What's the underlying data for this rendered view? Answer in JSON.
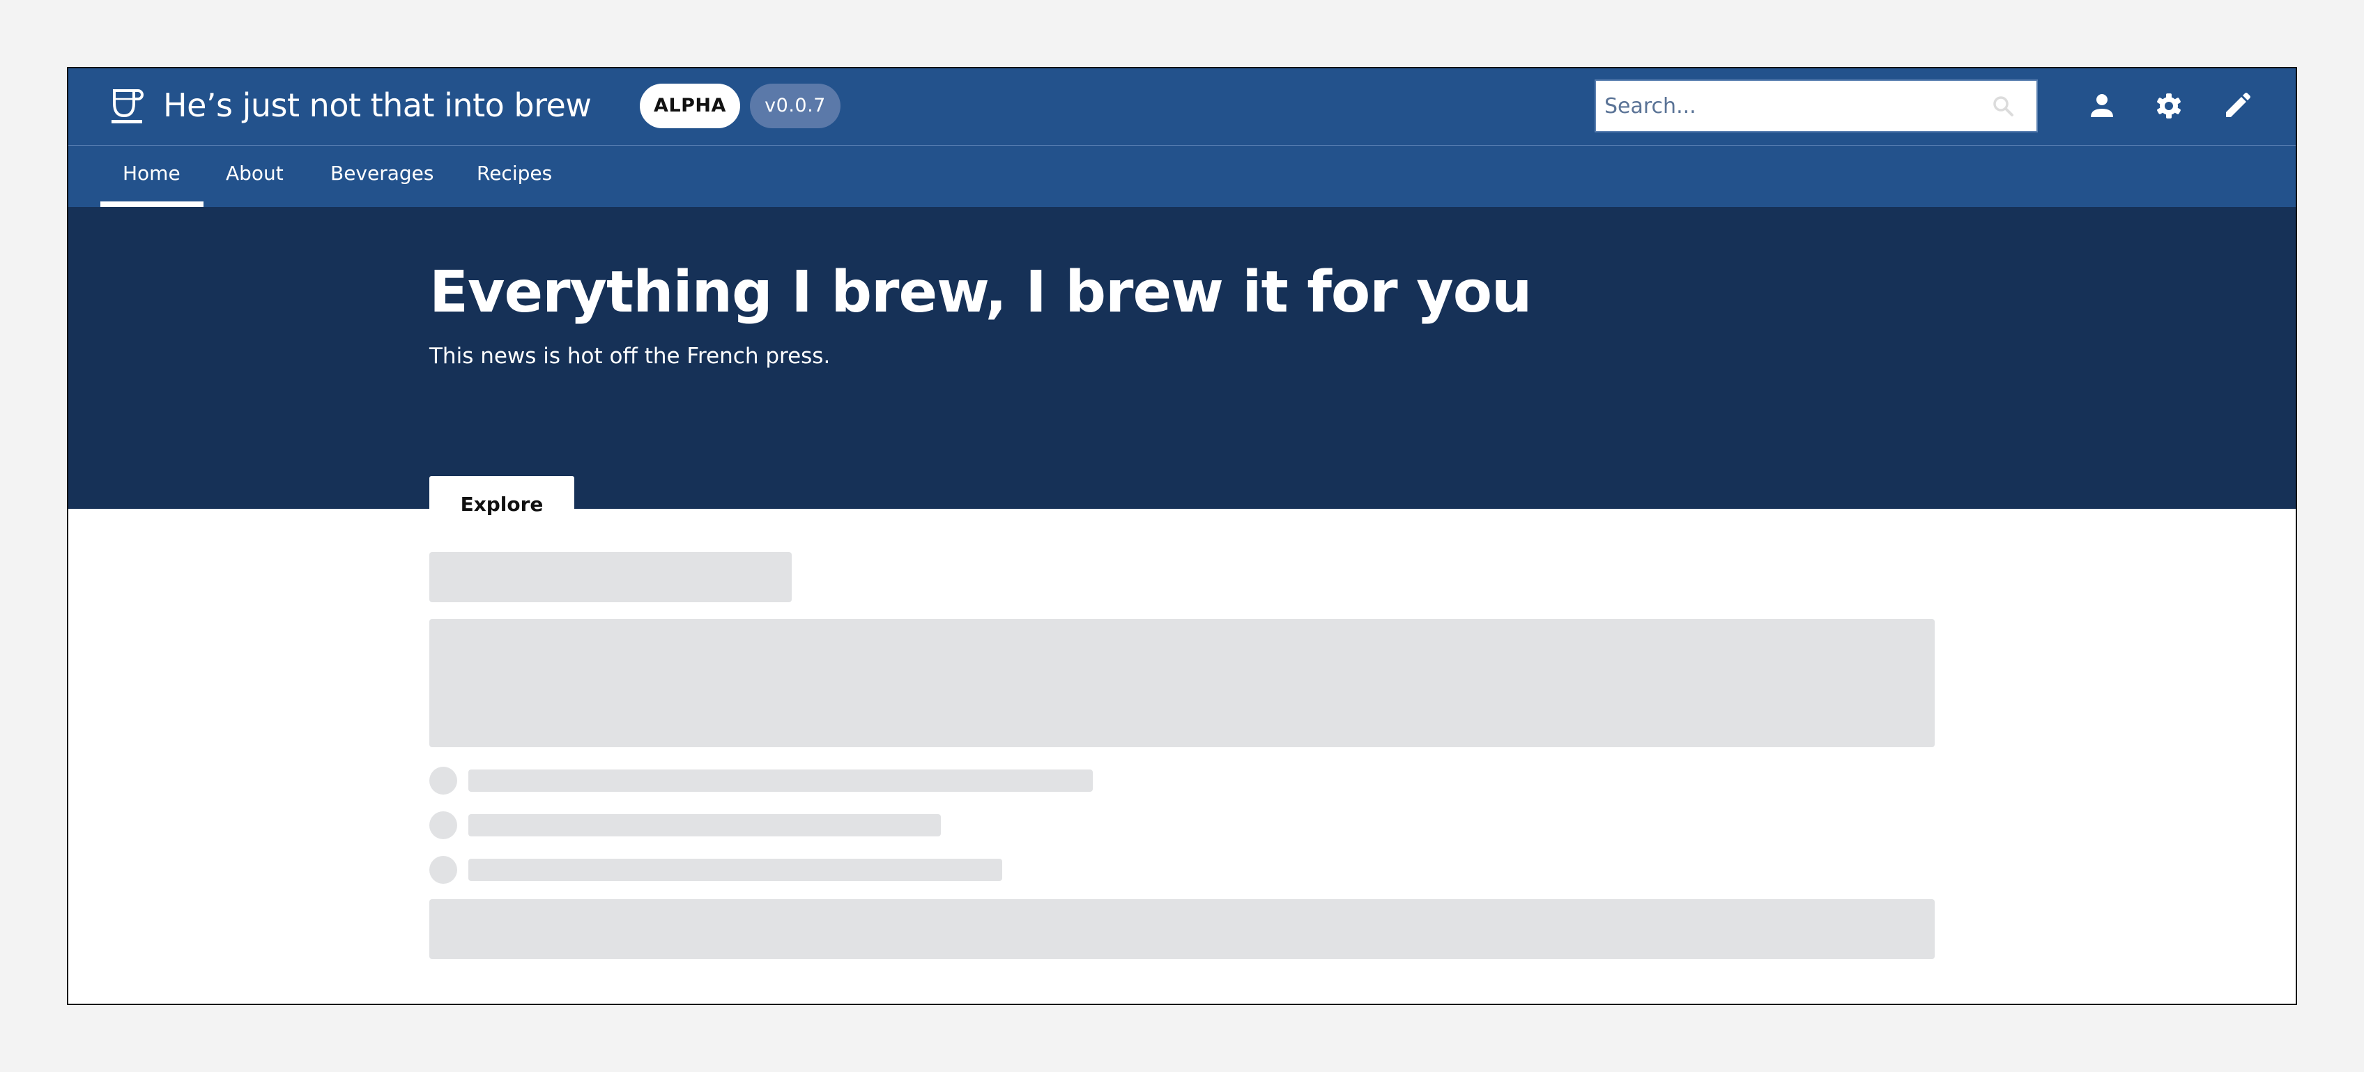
{
  "header": {
    "site_title": "He’s just not that into brew",
    "logo_icon": "coffee-cup-icon",
    "badges": {
      "stage": "ALPHA",
      "version": "v0.0.7"
    },
    "search": {
      "placeholder": "Search...",
      "value": "",
      "icon": "search-icon"
    },
    "actions": [
      {
        "name": "account",
        "icon": "user-icon"
      },
      {
        "name": "settings",
        "icon": "gear-icon"
      },
      {
        "name": "edit",
        "icon": "pencil-icon"
      }
    ]
  },
  "nav": {
    "items": [
      {
        "label": "Home",
        "active": true
      },
      {
        "label": "About",
        "active": false
      },
      {
        "label": "Beverages",
        "active": false
      },
      {
        "label": "Recipes",
        "active": false
      }
    ]
  },
  "hero": {
    "title": "Everything I brew, I brew it for you",
    "subtitle": "This news is hot off the French press.",
    "cta_label": "Explore"
  },
  "content": {
    "state": "loading",
    "skeleton_list_items": 3
  },
  "colors": {
    "header_bg": "#23528c",
    "hero_bg": "#163157",
    "skeleton": "#e1e2e4",
    "page_bg": "#f3f3f3"
  }
}
